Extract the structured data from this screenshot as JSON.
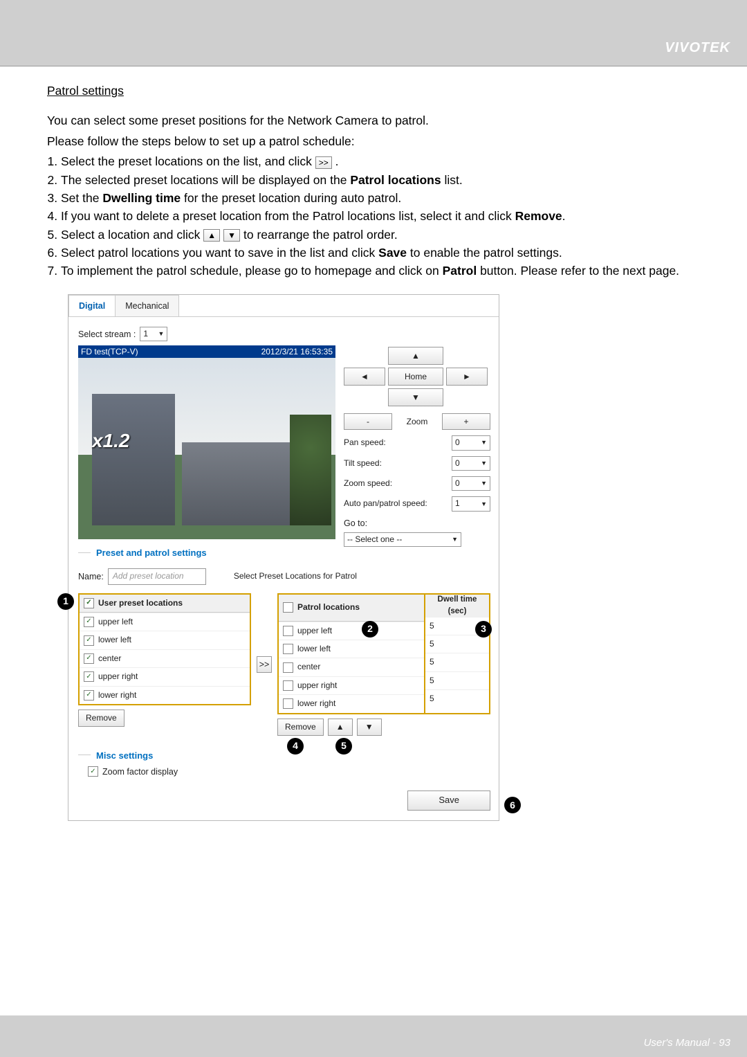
{
  "header": {
    "brand": "VIVOTEK"
  },
  "doc": {
    "section_title": "Patrol settings",
    "intro1": "You can select some preset positions for the Network Camera to patrol.",
    "intro2": "Please follow the steps below to set up a patrol schedule:",
    "step1a": "Select the preset locations on the list, and click ",
    "step1_btn": ">>",
    "step1b": ".",
    "step2a": "The selected preset locations will be displayed on the ",
    "step2b": " list.",
    "step3a": "Set the ",
    "step3b": " for the preset location during auto patrol.",
    "step4a": "If you want to delete a preset location from the Patrol locations list, select it and click ",
    "step4b": ".",
    "step5a": "Select a location and click ",
    "step5_up": "▲",
    "step5_down": "▼",
    "step5b": " to rearrange the patrol order.",
    "step6a": "Select patrol locations you want to save in the list and click ",
    "step6b": " to enable the patrol settings.",
    "step7a": "To implement the patrol schedule, please go to homepage and click on ",
    "step7b": " button. Please refer to the next page.",
    "bold": {
      "patrol_locations": "Patrol locations",
      "dwelling_time": "Dwelling time",
      "remove": "Remove",
      "save": "Save",
      "patrol": "Patrol"
    }
  },
  "panel": {
    "tabs": {
      "digital": "Digital",
      "mechanical": "Mechanical"
    },
    "select_stream_label": "Select stream :",
    "select_stream_value": "1",
    "video_title": "FD test(TCP-V)",
    "video_time": "2012/3/21 16:53:35",
    "zoom_overlay": "x1.2",
    "dpad": {
      "up": "▲",
      "down": "▼",
      "left": "◄",
      "right": "►",
      "home": "Home"
    },
    "zoom": {
      "minus": "-",
      "label": "Zoom",
      "plus": "+"
    },
    "speeds": {
      "pan_label": "Pan speed:",
      "pan_val": "0",
      "tilt_label": "Tilt speed:",
      "tilt_val": "0",
      "zoom_label": "Zoom speed:",
      "zoom_val": "0",
      "auto_label": "Auto pan/patrol speed:",
      "auto_val": "1"
    },
    "goto_label": "Go to:",
    "goto_value": "-- Select one --",
    "preset_section": "Preset and patrol settings",
    "name_label": "Name:",
    "name_placeholder": "Add preset location",
    "select_patrol_label": "Select Preset Locations for Patrol",
    "user_preset_header": "User preset locations",
    "user_preset": [
      "upper left",
      "lower left",
      "center",
      "upper right",
      "lower right"
    ],
    "remove_btn": "Remove",
    "add_btn": ">>",
    "patrol_header": "Patrol locations",
    "patrol": [
      "upper left",
      "lower left",
      "center",
      "upper right",
      "lower right"
    ],
    "dwell_header_l1": "Dwell time",
    "dwell_header_l2": "(sec)",
    "dwell": [
      "5",
      "5",
      "5",
      "5",
      "5"
    ],
    "up_btn": "▲",
    "down_btn": "▼",
    "misc_section": "Misc settings",
    "zoom_factor_label": "Zoom factor display",
    "save_btn": "Save"
  },
  "callouts": {
    "c1": "1",
    "c2": "2",
    "c3": "3",
    "c4": "4",
    "c5": "5",
    "c6": "6"
  },
  "footer": {
    "text": "User's Manual - 93"
  }
}
